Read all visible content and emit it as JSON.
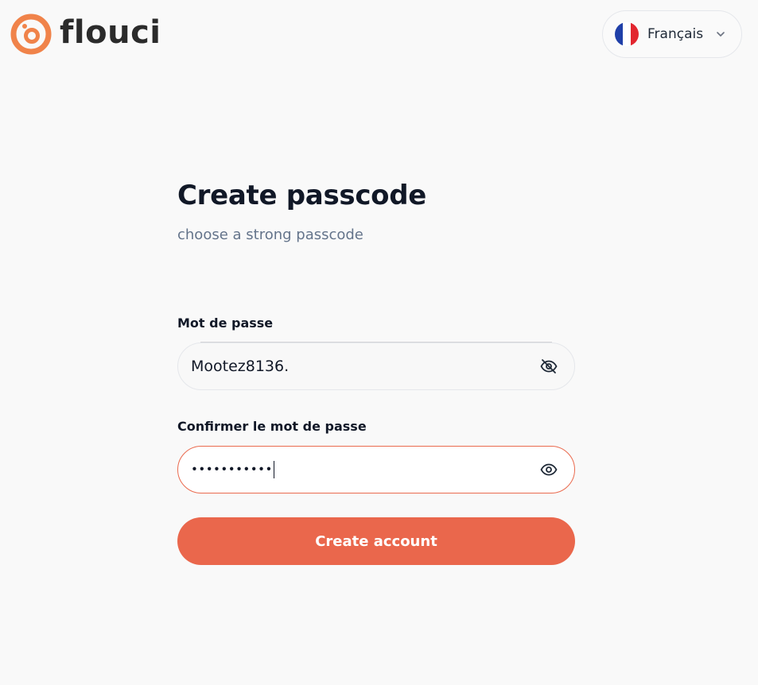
{
  "brand": {
    "name": "flouci",
    "logo_icon": "flouci-logo-icon",
    "accent_color": "#ea674c"
  },
  "language": {
    "selected": "Français",
    "flag_icon": "france-flag-icon",
    "chevron_icon": "chevron-down-icon"
  },
  "page": {
    "title": "Create passcode",
    "subtitle": "choose a strong passcode"
  },
  "form": {
    "password": {
      "label": "Mot de passe",
      "value": "Mootez8136.",
      "visible": true,
      "toggle_icon": "eye-off-icon"
    },
    "confirm_password": {
      "label": "Confirmer le mot de passe",
      "masked_value": "•••••••••••",
      "visible": false,
      "focused": true,
      "error": true,
      "toggle_icon": "eye-icon"
    },
    "submit_label": "Create account"
  }
}
